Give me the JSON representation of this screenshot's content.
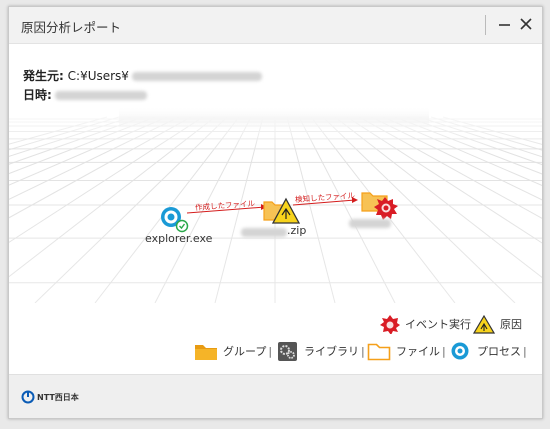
{
  "window": {
    "title": "原因分析レポート"
  },
  "info": {
    "source_label": "発生元:",
    "source_path": "C:¥Users¥",
    "datetime_label": "日時:"
  },
  "graph": {
    "nodes": {
      "explorer": "explorer.exe",
      "zip": ".zip"
    },
    "edges": {
      "created": "作成したファイル",
      "detected": "検知したファイル"
    }
  },
  "legend": {
    "event": "イベント実行",
    "cause": "原因",
    "group": "グループ",
    "library": "ライブラリ",
    "file": "ファイル",
    "process": "プロセス"
  },
  "footer": {
    "logo_text": "NTT西日本"
  },
  "colors": {
    "process_blue": "#1a9ad6",
    "folder_orange": "#f5a01a",
    "cause_yellow": "#f7d31c",
    "event_red": "#d91c25",
    "edge_red": "#d41d1d"
  }
}
